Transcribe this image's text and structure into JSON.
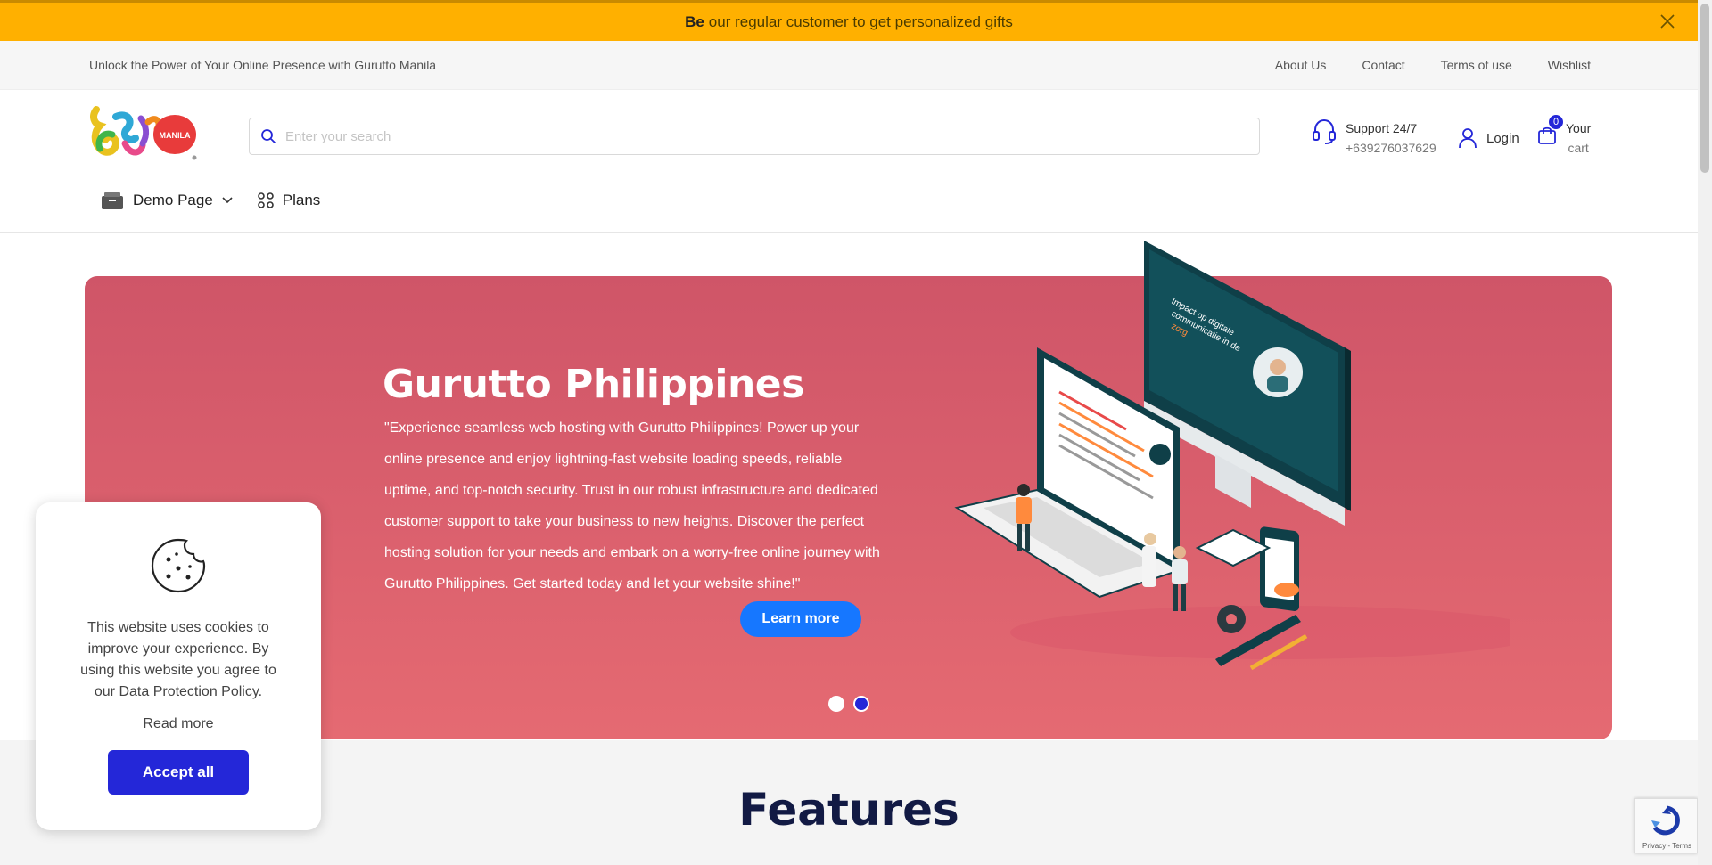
{
  "promo": {
    "bold": "Be",
    "text": "our regular customer to get personalized gifts"
  },
  "topbar": {
    "tagline": "Unlock the Power of Your Online Presence with Gurutto Manila",
    "links": [
      "About Us",
      "Contact",
      "Terms of use",
      "Wishlist"
    ]
  },
  "header": {
    "logo_text": "MANILA",
    "search_placeholder": "Enter your search",
    "support_label": "Support 24/7",
    "support_phone": "+639276037629",
    "login_label": "Login",
    "cart_count": "0",
    "cart_label_1": "Your",
    "cart_label_2": "cart"
  },
  "nav": {
    "demo_page": "Demo Page",
    "plans": "Plans"
  },
  "hero": {
    "title": "Gurutto Philippines",
    "body": "\"Experience seamless web hosting with Gurutto Philippines! Power up your online presence and enjoy lightning-fast website loading speeds, reliable uptime, and top-notch security. Trust in our robust infrastructure and dedicated customer support to take your business to new heights. Discover the perfect hosting solution for your needs and embark on a worry-free online journey with Gurutto Philippines. Get started today and let your website shine!\"",
    "button": "Learn more",
    "slides": 2,
    "active_slide": 2,
    "illustration_text_1": "Impact op digitale",
    "illustration_text_2": "communicatie in de",
    "illustration_text_3": "zorg"
  },
  "features": {
    "title": "Features"
  },
  "cookie": {
    "message": "This website uses cookies to improve your experience. By using this website you agree to our Data Protection Policy.",
    "read_more": "Read more",
    "accept": "Accept all"
  },
  "recaptcha": {
    "text": "Privacy - Terms"
  },
  "colors": {
    "promo": "#FFB000",
    "accent": "#2427d8",
    "hero_top": "#cf5568",
    "hero_bottom": "#e56a72",
    "button_blue": "#1677ff"
  }
}
